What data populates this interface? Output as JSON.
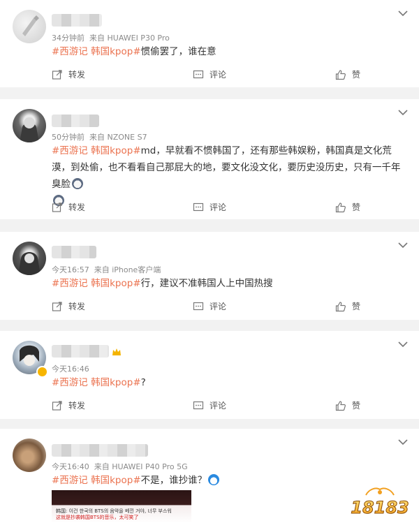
{
  "actions": {
    "repost": "转发",
    "comment": "评论",
    "like": "赞"
  },
  "comments": [
    {
      "time": "34分钟前",
      "source": "来自 HUAWEI P30 Pro",
      "tags": "#西游记 韩国kpop#",
      "text": "惯偷罢了，谁在意"
    },
    {
      "time": "50分钟前",
      "source": "来自 NZONE S7",
      "tags": "#西游记 韩国kpop#",
      "text": "md，早就看不惯韩国了，还有那些韩娱粉，韩国真是文化荒漠，到处偷，也不看看自己那屁大的地，要文化没文化，要历史没历史，只有一千年臭脸"
    },
    {
      "time": "今天16:57",
      "source": "来自 iPhone客户端",
      "tags": "#西游记 韩国kpop#",
      "text": "行，建议不准韩国人上中国热搜"
    },
    {
      "time": "今天16:46",
      "source": "",
      "tags": "#西游记 韩国kpop#",
      "text": "?"
    },
    {
      "time": "今天16:40",
      "source": "来自 HUAWEI P40 Pro 5G",
      "tags": "#西游记 韩国kpop#",
      "text": "不是，谁抄谁？"
    }
  ],
  "thumbnail": {
    "line1": "韩国: 이건 한국의 BTS의 음악을 베낀 거야, 너무 부스워",
    "line2": "这就是抄袭韩国BTS的音乐，太可笑了"
  },
  "watermark": "18183",
  "colors": {
    "tag": "#eb7350",
    "meta": "#8a8a8a",
    "background": "#f2f2f2"
  }
}
